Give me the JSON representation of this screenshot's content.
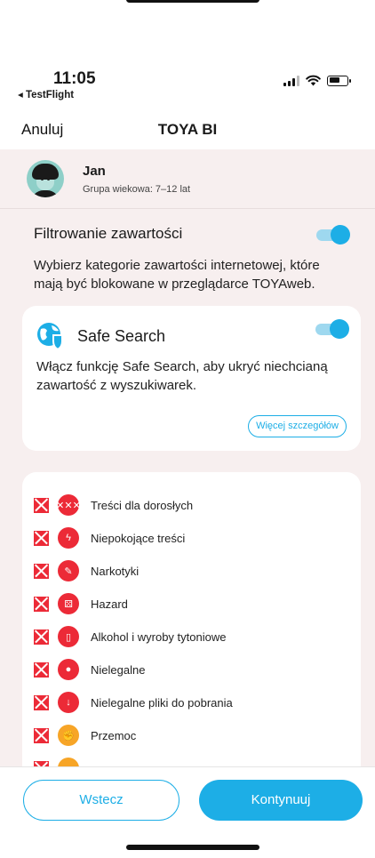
{
  "status_bar": {
    "time": "11:05",
    "back_app": "◂ TestFlight"
  },
  "nav": {
    "cancel": "Anuluj",
    "title": "TOYA BI"
  },
  "profile": {
    "name": "Jan",
    "age_group": "Grupa wiekowa: 7–12 lat"
  },
  "filter": {
    "title": "Filtrowanie zawartości",
    "enabled": true,
    "description": "Wybierz kategorie zawartości internetowej, które mają być blokowane w przeglądarce TOYAweb."
  },
  "safe_search": {
    "title": "Safe Search",
    "enabled": true,
    "description": "Włącz funkcję Safe Search, aby ukryć niechcianą zawartość z wyszukiwarek.",
    "details_label": "Więcej szczegółów"
  },
  "categories": [
    {
      "label": "Treści dla dorosłych",
      "icon": "xxx-icon",
      "color": "#ec2a37",
      "blocked": true
    },
    {
      "label": "Niepokojące treści",
      "icon": "lightning-icon",
      "color": "#ec2a37",
      "blocked": true
    },
    {
      "label": "Narkotyki",
      "icon": "syringe-icon",
      "color": "#ec2a37",
      "blocked": true
    },
    {
      "label": "Hazard",
      "icon": "dice-icon",
      "color": "#ec2a37",
      "blocked": true
    },
    {
      "label": "Alkohol i wyroby tytoniowe",
      "icon": "bottle-icon",
      "color": "#ec2a37",
      "blocked": true
    },
    {
      "label": "Nielegalne",
      "icon": "thief-icon",
      "color": "#ec2a37",
      "blocked": true
    },
    {
      "label": "Nielegalne pliki do pobrania",
      "icon": "download-icon",
      "color": "#ec2a37",
      "blocked": true
    },
    {
      "label": "Przemoc",
      "icon": "fist-icon",
      "color": "#f7a527",
      "blocked": true
    }
  ],
  "buttons": {
    "back": "Wstecz",
    "next": "Kontynuuj"
  },
  "colors": {
    "accent": "#1daee6",
    "danger": "#ec2a37",
    "warning": "#f7a527",
    "panel_bg": "#f7efef"
  }
}
